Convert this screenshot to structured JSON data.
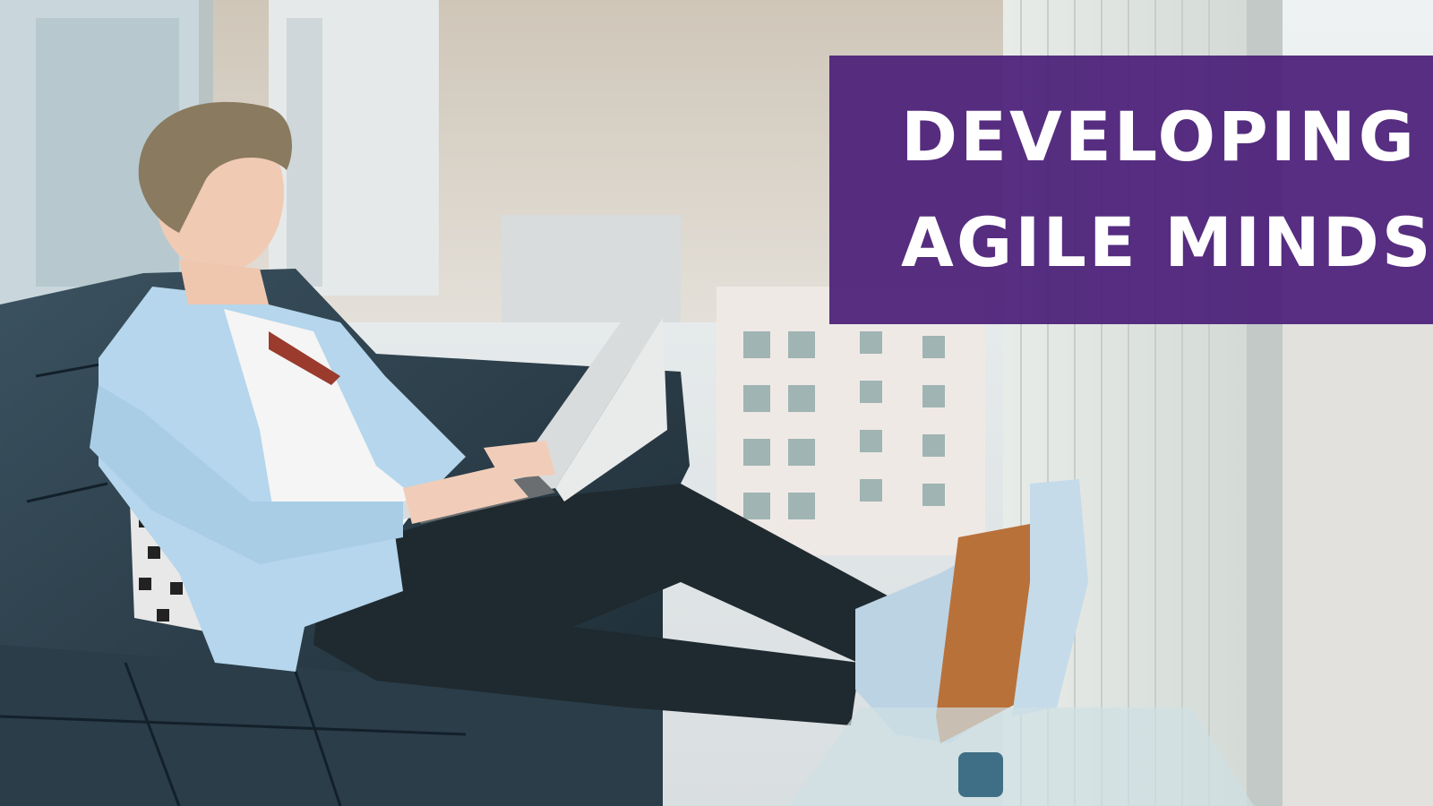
{
  "banner": {
    "line1": "DEVELOPING AN",
    "line2": "AGILE MINDSET",
    "background_color": "#4b1f78",
    "text_color": "#ffffff"
  }
}
